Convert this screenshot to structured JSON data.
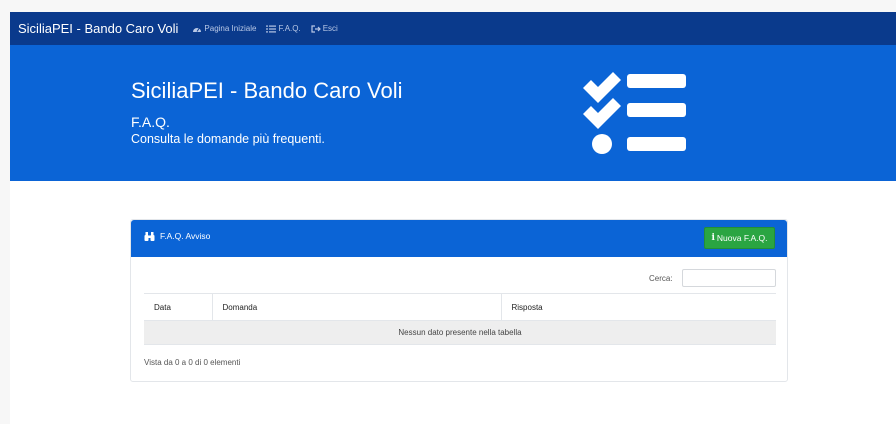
{
  "navbar": {
    "brand": "SiciliaPEI - Bando Caro Voli",
    "links": [
      {
        "icon": "dashboard-icon",
        "label": "Pagina Iniziale"
      },
      {
        "icon": "list-icon",
        "label": "F.A.Q."
      },
      {
        "icon": "sign-out-icon",
        "label": "Esci"
      }
    ]
  },
  "hero": {
    "title": "SiciliaPEI - Bando Caro Voli",
    "subtitle": "F.A.Q.",
    "description": "Consulta le domande più frequenti.",
    "icon": "checklist-icon"
  },
  "panel": {
    "title": "F.A.Q. Avviso",
    "title_icon": "binoculars-icon",
    "new_button": "Nuova F.A.Q.",
    "search_label": "Cerca:",
    "search_value": "",
    "columns": [
      "Data",
      "Domanda",
      "Risposta"
    ],
    "empty_message": "Nessun dato presente nella tabella",
    "info": "Vista da 0 a 0 di 0 elementi"
  },
  "colors": {
    "navbar": "#0a3a8c",
    "primary": "#0b64d6",
    "success": "#2aa542"
  }
}
